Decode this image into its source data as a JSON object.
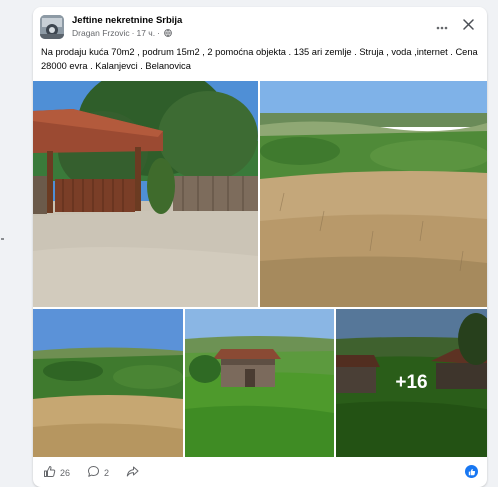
{
  "post": {
    "group_name": "Jeftine nekretnine Srbija",
    "author": "Dragan Frzovic",
    "separator": "·",
    "time": "17 ч.",
    "text": "Na prodaju kuća 70m2 , podrum 15m2 , 2 pomoćna objekta . 135 ari zemlje . Struja , voda ,internet . Cena 28000 evra . Kalanjevci . Belanovica",
    "more_photos_label": "+16",
    "reactions_count": "26",
    "comments_count": "2"
  },
  "icons": {
    "more": "more-horizontal-icon",
    "close": "close-icon",
    "audience": "globe-icon",
    "like": "thumbs-up-icon",
    "comment": "comment-icon",
    "share": "share-icon"
  },
  "colors": {
    "background": "#f0f2f5",
    "card": "#ffffff",
    "secondary_text": "#65676b",
    "accent": "#1877f2"
  }
}
